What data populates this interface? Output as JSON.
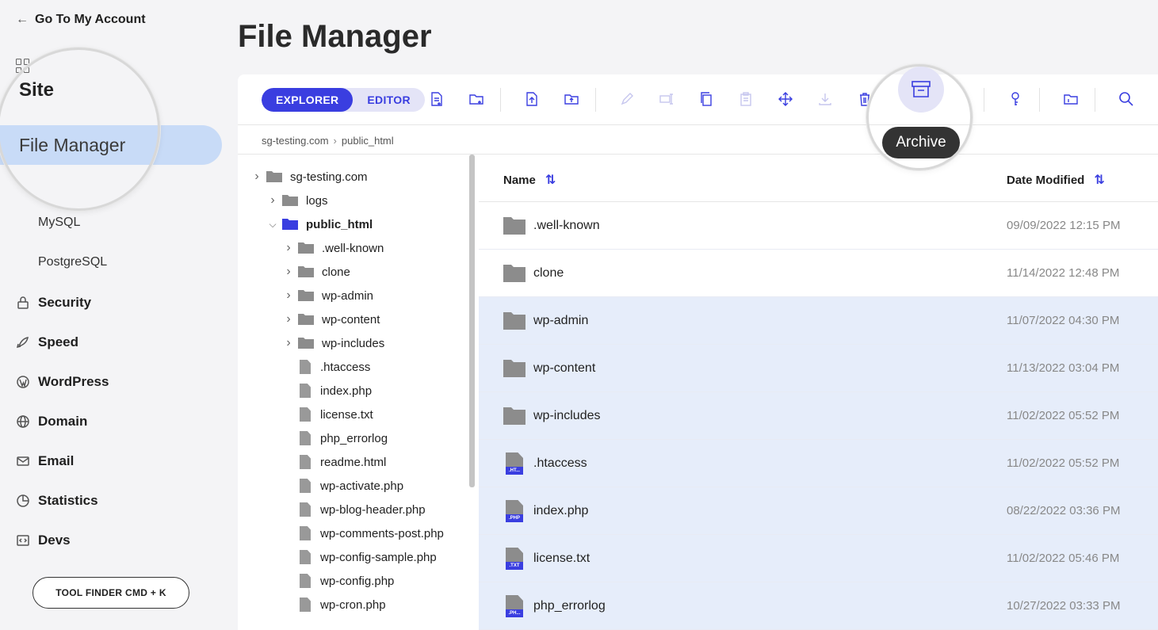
{
  "sidebar": {
    "back_label": "Go To My Account",
    "section_label": "Site",
    "active_item": "File Manager",
    "sub_items": [
      "MySQL",
      "PostgreSQL"
    ],
    "nav_items": [
      {
        "label": "Security",
        "icon": "lock-icon"
      },
      {
        "label": "Speed",
        "icon": "rocket-icon"
      },
      {
        "label": "WordPress",
        "icon": "wordpress-icon"
      },
      {
        "label": "Domain",
        "icon": "globe-icon"
      },
      {
        "label": "Email",
        "icon": "mail-icon"
      },
      {
        "label": "Statistics",
        "icon": "pie-chart-icon"
      },
      {
        "label": "Devs",
        "icon": "code-icon"
      }
    ],
    "tool_finder": "TOOL FINDER CMD + K"
  },
  "main": {
    "title": "File Manager",
    "tabs": [
      "EXPLORER",
      "EDITOR"
    ],
    "active_tab": "EXPLORER",
    "tooltip": "Archive",
    "breadcrumb": [
      "sg-testing.com",
      "public_html"
    ]
  },
  "tree": [
    {
      "label": "sg-testing.com",
      "type": "folder",
      "depth": 0,
      "expanded": false
    },
    {
      "label": "logs",
      "type": "folder",
      "depth": 1,
      "expanded": false
    },
    {
      "label": "public_html",
      "type": "folder",
      "depth": 1,
      "expanded": true,
      "active": true
    },
    {
      "label": ".well-known",
      "type": "folder",
      "depth": 2
    },
    {
      "label": "clone",
      "type": "folder",
      "depth": 2
    },
    {
      "label": "wp-admin",
      "type": "folder",
      "depth": 2
    },
    {
      "label": "wp-content",
      "type": "folder",
      "depth": 2
    },
    {
      "label": "wp-includes",
      "type": "folder",
      "depth": 2
    },
    {
      "label": ".htaccess",
      "type": "file",
      "depth": 2
    },
    {
      "label": "index.php",
      "type": "file",
      "depth": 2
    },
    {
      "label": "license.txt",
      "type": "file",
      "depth": 2
    },
    {
      "label": "php_errorlog",
      "type": "file",
      "depth": 2
    },
    {
      "label": "readme.html",
      "type": "file",
      "depth": 2
    },
    {
      "label": "wp-activate.php",
      "type": "file",
      "depth": 2
    },
    {
      "label": "wp-blog-header.php",
      "type": "file",
      "depth": 2
    },
    {
      "label": "wp-comments-post.php",
      "type": "file",
      "depth": 2
    },
    {
      "label": "wp-config-sample.php",
      "type": "file",
      "depth": 2
    },
    {
      "label": "wp-config.php",
      "type": "file",
      "depth": 2
    },
    {
      "label": "wp-cron.php",
      "type": "file",
      "depth": 2
    }
  ],
  "list": {
    "columns": [
      "Name",
      "Date Modified"
    ],
    "rows": [
      {
        "name": ".well-known",
        "date": "09/09/2022 12:15 PM",
        "type": "folder",
        "selected": false
      },
      {
        "name": "clone",
        "date": "11/14/2022 12:48 PM",
        "type": "folder",
        "selected": false
      },
      {
        "name": "wp-admin",
        "date": "11/07/2022 04:30 PM",
        "type": "folder",
        "selected": true
      },
      {
        "name": "wp-content",
        "date": "11/13/2022 03:04 PM",
        "type": "folder",
        "selected": true
      },
      {
        "name": "wp-includes",
        "date": "11/02/2022 05:52 PM",
        "type": "folder",
        "selected": true
      },
      {
        "name": ".htaccess",
        "date": "11/02/2022 05:52 PM",
        "type": "file",
        "tag": ".HT...",
        "selected": true
      },
      {
        "name": "index.php",
        "date": "08/22/2022 03:36 PM",
        "type": "file",
        "tag": ".PHP",
        "selected": true
      },
      {
        "name": "license.txt",
        "date": "11/02/2022 05:46 PM",
        "type": "file",
        "tag": ".TXT",
        "selected": true
      },
      {
        "name": "php_errorlog",
        "date": "10/27/2022 03:33 PM",
        "type": "file",
        "tag": ".PH...",
        "selected": true
      }
    ]
  },
  "colors": {
    "accent": "#3a3ee0",
    "selected_row": "#e6edfa",
    "active_nav": "#c8dbf7",
    "folder": "#8c8c8c"
  }
}
